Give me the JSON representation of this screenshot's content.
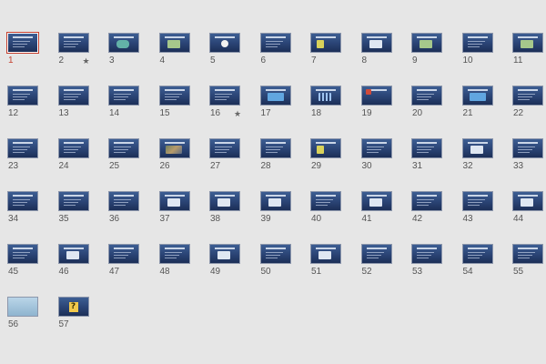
{
  "view": "slide-sorter",
  "selected_slide": "1",
  "colors": {
    "selection": "#c4402f",
    "slide_bg": "#2a4374",
    "canvas": "#e6e6e6"
  },
  "transition_icon": "star-icon",
  "slides": [
    {
      "num": "1",
      "trans": false
    },
    {
      "num": "2",
      "trans": true
    },
    {
      "num": "3",
      "trans": false
    },
    {
      "num": "4",
      "trans": false
    },
    {
      "num": "5",
      "trans": false
    },
    {
      "num": "6",
      "trans": false
    },
    {
      "num": "7",
      "trans": false
    },
    {
      "num": "8",
      "trans": false
    },
    {
      "num": "9",
      "trans": false
    },
    {
      "num": "10",
      "trans": false
    },
    {
      "num": "11",
      "trans": false
    },
    {
      "num": "12",
      "trans": false
    },
    {
      "num": "13",
      "trans": false
    },
    {
      "num": "14",
      "trans": false
    },
    {
      "num": "15",
      "trans": false
    },
    {
      "num": "16",
      "trans": true
    },
    {
      "num": "17",
      "trans": false
    },
    {
      "num": "18",
      "trans": false
    },
    {
      "num": "19",
      "trans": false
    },
    {
      "num": "20",
      "trans": false
    },
    {
      "num": "21",
      "trans": false
    },
    {
      "num": "22",
      "trans": false
    },
    {
      "num": "23",
      "trans": false
    },
    {
      "num": "24",
      "trans": false
    },
    {
      "num": "25",
      "trans": false
    },
    {
      "num": "26",
      "trans": false
    },
    {
      "num": "27",
      "trans": false
    },
    {
      "num": "28",
      "trans": false
    },
    {
      "num": "29",
      "trans": false
    },
    {
      "num": "30",
      "trans": false
    },
    {
      "num": "31",
      "trans": false
    },
    {
      "num": "32",
      "trans": false
    },
    {
      "num": "33",
      "trans": false
    },
    {
      "num": "34",
      "trans": false
    },
    {
      "num": "35",
      "trans": false
    },
    {
      "num": "36",
      "trans": false
    },
    {
      "num": "37",
      "trans": false
    },
    {
      "num": "38",
      "trans": false
    },
    {
      "num": "39",
      "trans": false
    },
    {
      "num": "40",
      "trans": false
    },
    {
      "num": "41",
      "trans": false
    },
    {
      "num": "42",
      "trans": false
    },
    {
      "num": "43",
      "trans": false
    },
    {
      "num": "44",
      "trans": false
    },
    {
      "num": "45",
      "trans": false
    },
    {
      "num": "46",
      "trans": false
    },
    {
      "num": "47",
      "trans": false
    },
    {
      "num": "48",
      "trans": false
    },
    {
      "num": "49",
      "trans": false
    },
    {
      "num": "50",
      "trans": false
    },
    {
      "num": "51",
      "trans": false
    },
    {
      "num": "52",
      "trans": false
    },
    {
      "num": "53",
      "trans": false
    },
    {
      "num": "54",
      "trans": false
    },
    {
      "num": "55",
      "trans": false
    },
    {
      "num": "56",
      "trans": false
    },
    {
      "num": "57",
      "trans": false
    }
  ]
}
